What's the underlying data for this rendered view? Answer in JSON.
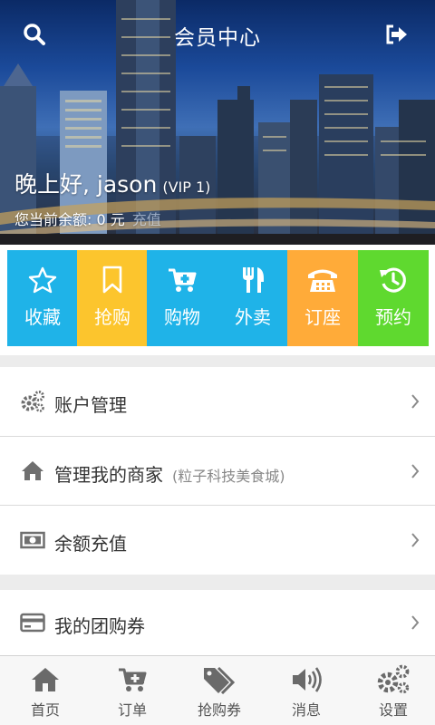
{
  "header": {
    "title": "会员中心",
    "greeting": "晚上好,  jason",
    "vip": "(VIP 1)",
    "balance_text": "您当前余额:  0 元",
    "recharge_label": "充值",
    "search_icon": "search-icon",
    "logout_icon": "logout-icon"
  },
  "tiles": [
    {
      "label": "收藏",
      "icon": "star-icon",
      "color": "#1fb3e8"
    },
    {
      "label": "抢购",
      "icon": "bookmark-icon",
      "color": "#fcc52d"
    },
    {
      "label": "购物",
      "icon": "cart-icon",
      "color": "#1fb3e8"
    },
    {
      "label": "外卖",
      "icon": "utensils-icon",
      "color": "#1fb3e8"
    },
    {
      "label": "订座",
      "icon": "phone-icon",
      "color": "#ffab39"
    },
    {
      "label": "预约",
      "icon": "history-icon",
      "color": "#5fd92f"
    }
  ],
  "menu": [
    {
      "label": "账户管理",
      "sub": "",
      "icon": "gears-icon"
    },
    {
      "label": "管理我的商家",
      "sub": "(粒子科技美食城)",
      "icon": "home-icon"
    },
    {
      "label": "余额充值",
      "sub": "",
      "icon": "money-icon"
    },
    {
      "label": "我的团购券",
      "sub": "",
      "icon": "credit-card-icon"
    }
  ],
  "bottom_nav": [
    {
      "label": "首页",
      "icon": "home-icon"
    },
    {
      "label": "订单",
      "icon": "cart-plus-icon"
    },
    {
      "label": "抢购券",
      "icon": "tags-icon"
    },
    {
      "label": "消息",
      "icon": "volume-icon"
    },
    {
      "label": "设置",
      "icon": "gears-icon"
    }
  ],
  "colors": {
    "accent": "#1fb3e8",
    "yellow": "#fcc52d",
    "orange": "#ffab39",
    "green": "#5fd92f",
    "icon_gray": "#6f6f6f"
  }
}
